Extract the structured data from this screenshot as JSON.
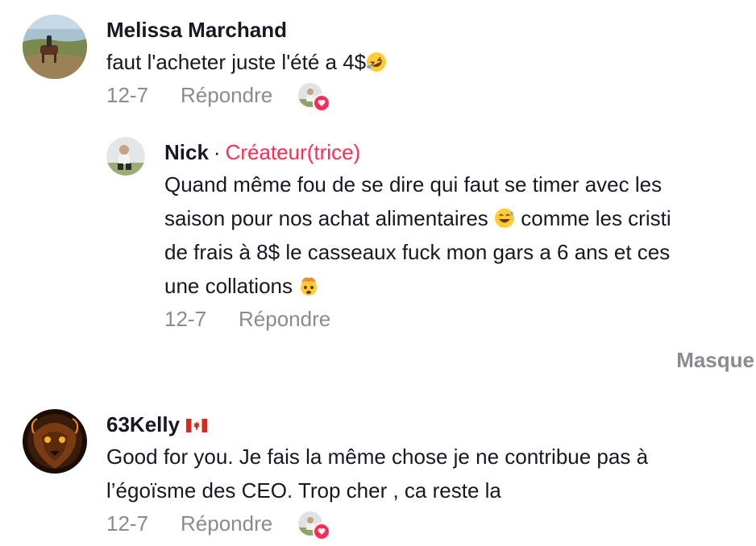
{
  "comments": [
    {
      "author": "Melissa Marchand",
      "text": "faut l'acheter juste l'été a 4$",
      "emoji_icon": "rolling-on-floor-laughing-emoji",
      "date": "12-7",
      "reply_label": "Répondre",
      "liked_by_creator": true
    },
    {
      "author": "Nick",
      "separator": "·",
      "badge": "Créateur(trice)",
      "lines": [
        "Quand même fou de se dire qui faut se timer avec les",
        "saison pour nos achat alimentaires",
        "comme les cristi",
        "de frais à 8$ le casseaux fuck mon gars a 6 ans et ces",
        "une collations"
      ],
      "emoji_icons": [
        "grinning-sweat-emoji",
        "exploding-head-emoji"
      ],
      "date": "12-7",
      "reply_label": "Répondre"
    },
    {
      "author": "63Kelly",
      "flag_icon": "canada-flag-icon",
      "lines": [
        "Good for you. Je fais la même chose je ne contribue pas à",
        "l’égoïsme des CEO. Trop cher , ca reste la"
      ],
      "date": "12-7",
      "reply_label": "Répondre",
      "liked_by_creator": true
    }
  ],
  "hide_label": "Masque",
  "colors": {
    "accent": "#fe2c55",
    "text": "#161823",
    "muted": "#8a8b91"
  }
}
